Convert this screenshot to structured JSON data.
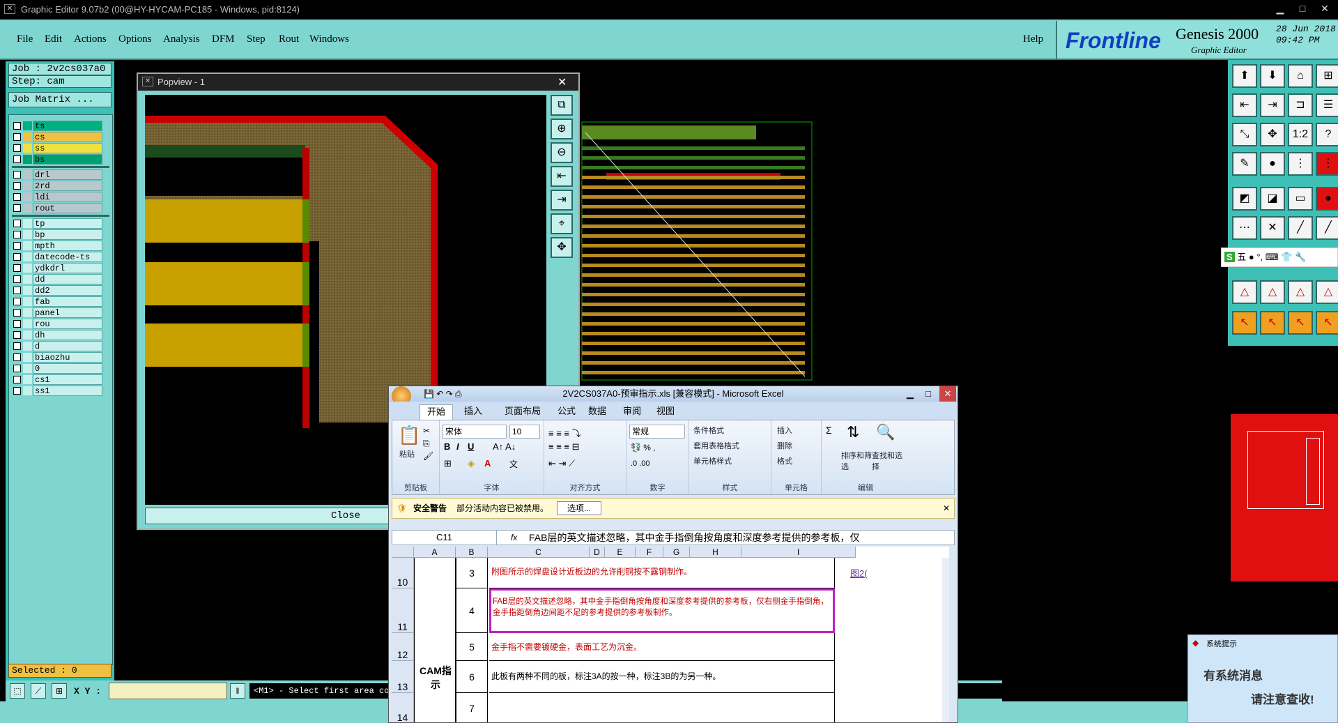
{
  "titlebar": {
    "title": "Graphic Editor 9.07b2 (00@HY-HYCAM-PC185 - Windows, pid:8124)"
  },
  "menu": {
    "items": [
      "File",
      "Edit",
      "Actions",
      "Options",
      "Analysis",
      "DFM",
      "Step",
      "Rout",
      "Windows"
    ],
    "help": "Help"
  },
  "logo": {
    "brand": "Frontline",
    "product": "Genesis 2000",
    "subtitle": "Graphic Editor",
    "date": "28 Jun 2018",
    "time": "09:42 PM"
  },
  "left": {
    "job": "Job : 2v2cs037a0",
    "step": "Step: cam",
    "job_matrix": "Job Matrix ...",
    "layers_top": [
      {
        "name": "ts",
        "color": "#00b080"
      },
      {
        "name": "cs",
        "color": "#f0c040"
      },
      {
        "name": "ss",
        "color": "#f0e040"
      },
      {
        "name": "bs",
        "color": "#00a070"
      }
    ],
    "layers_drill": [
      "drl",
      "2rd",
      "ldi",
      "rout"
    ],
    "layers_misc": [
      "tp",
      "bp",
      "mpth",
      "datecode-ts",
      "ydkdrl",
      "dd",
      "dd2",
      "fab",
      "panel",
      "rou",
      "dh",
      "d",
      "biaozhu",
      "0",
      "cs1",
      "ss1"
    ],
    "selected": "Selected : 0"
  },
  "status": {
    "xy_label": "X Y :",
    "message": "<M1> - Select first area corner"
  },
  "popview": {
    "title": "Popview - 1",
    "close": "Close"
  },
  "ime": {
    "text": "五 ● °, ⌨ 👕 🔧"
  },
  "notify": {
    "title": "系统提示",
    "line1": "有系统消息",
    "line2": "请注意查收!"
  },
  "excel": {
    "title": "2V2CS037A0-预审指示.xls  [兼容模式] - Microsoft Excel",
    "tabs": [
      "开始",
      "插入",
      "页面布局",
      "公式",
      "数据",
      "审阅",
      "视图"
    ],
    "font_name": "宋体",
    "font_size": "10",
    "num_format": "常规",
    "groups": [
      "剪贴板",
      "字体",
      "对齐方式",
      "数字",
      "样式",
      "单元格",
      "编辑"
    ],
    "paste": "粘贴",
    "styles": [
      "条件格式",
      "套用表格格式",
      "单元格样式"
    ],
    "cells_btns": [
      "插入",
      "删除",
      "格式"
    ],
    "edit_btns": [
      "排序和筛选",
      "查找和选择"
    ],
    "security": {
      "title": "安全警告",
      "text": "部分活动内容已被禁用。",
      "btn": "选项..."
    },
    "namebox": "C11",
    "formula": "FAB层的英文描述忽略，其中金手指倒角按角度和深度参考提供的参考板，仅",
    "columns": [
      "A",
      "B",
      "C",
      "D",
      "E",
      "F",
      "G",
      "H",
      "I"
    ],
    "rows": [
      {
        "row": "10",
        "num": "3",
        "text": "附图所示的焊盘设计近板边的允许削铜按不露铜制作。",
        "link": "图2("
      },
      {
        "row": "11",
        "num": "4",
        "text": "FAB层的英文描述忽略，其中金手指倒角按角度和深度参考提供的参考板，仅右侧金手指倒角，金手指距倒角边间距不足的参考提供的参考板制作。"
      },
      {
        "row": "12",
        "num": "5",
        "text": "金手指不需要镀硬金，表面工艺为沉金。"
      },
      {
        "row": "13",
        "num": "6",
        "text": "此板有两种不同的板，标注3A的按一种，标注3B的为另一种。"
      },
      {
        "row": "14",
        "num": "7",
        "text": ""
      }
    ],
    "cam_label": "CAM指示"
  }
}
